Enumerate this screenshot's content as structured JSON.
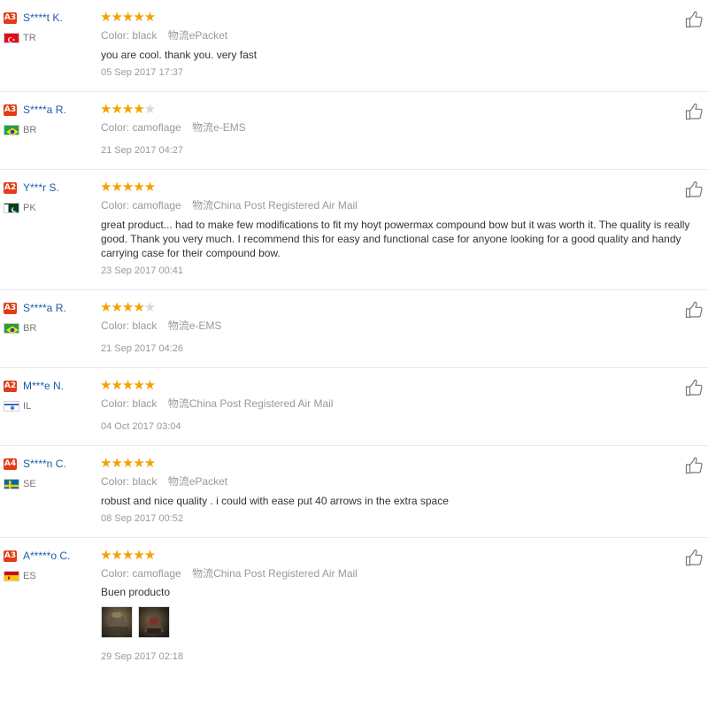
{
  "labels": {
    "color": "Color:",
    "shipping": "物流"
  },
  "colors": {
    "badge": "#e23c17",
    "name": "#1a5aa8",
    "star": "#f5a100",
    "star_empty": "#d9d9d9"
  },
  "reviews": [
    {
      "level": "A3",
      "name": "S****t K.",
      "country": "TR",
      "stars": 5,
      "color": "black",
      "shipping": "ePacket",
      "text": "you are cool. thank you. very fast",
      "date": "05 Sep 2017 17:37"
    },
    {
      "level": "A3",
      "name": "S****a R.",
      "country": "BR",
      "stars": 4,
      "color": "camoflage",
      "shipping": "e-EMS",
      "text": "",
      "date": "21 Sep 2017 04:27"
    },
    {
      "level": "A2",
      "name": "Y***r S.",
      "country": "PK",
      "stars": 5,
      "color": "camoflage",
      "shipping": "China Post Registered Air Mail",
      "text": "great product... had to make few modifications to fit my hoyt powermax compound bow but it was worth it. The quality is really good. Thank you very much. I recommend this for easy and functional case for anyone looking for a good quality and handy carrying case for their compound bow.",
      "date": "23 Sep 2017 00:41"
    },
    {
      "level": "A3",
      "name": "S****a R.",
      "country": "BR",
      "stars": 4,
      "color": "black",
      "shipping": "e-EMS",
      "text": "",
      "date": "21 Sep 2017 04:26"
    },
    {
      "level": "A2",
      "name": "M***e N.",
      "country": "IL",
      "stars": 5,
      "color": "black",
      "shipping": "China Post Registered Air Mail",
      "text": "",
      "date": "04 Oct 2017 03:04"
    },
    {
      "level": "A4",
      "name": "S****n C.",
      "country": "SE",
      "stars": 5,
      "color": "black",
      "shipping": "ePacket",
      "text": "robust and nice quality . i could with ease put 40 arrows in the extra space",
      "date": "08 Sep 2017 00:52"
    },
    {
      "level": "A3",
      "name": "A*****o C.",
      "country": "ES",
      "stars": 5,
      "color": "camoflage",
      "shipping": "China Post Registered Air Mail",
      "text": "Buen producto",
      "date": "29 Sep 2017 02:18"
    }
  ]
}
